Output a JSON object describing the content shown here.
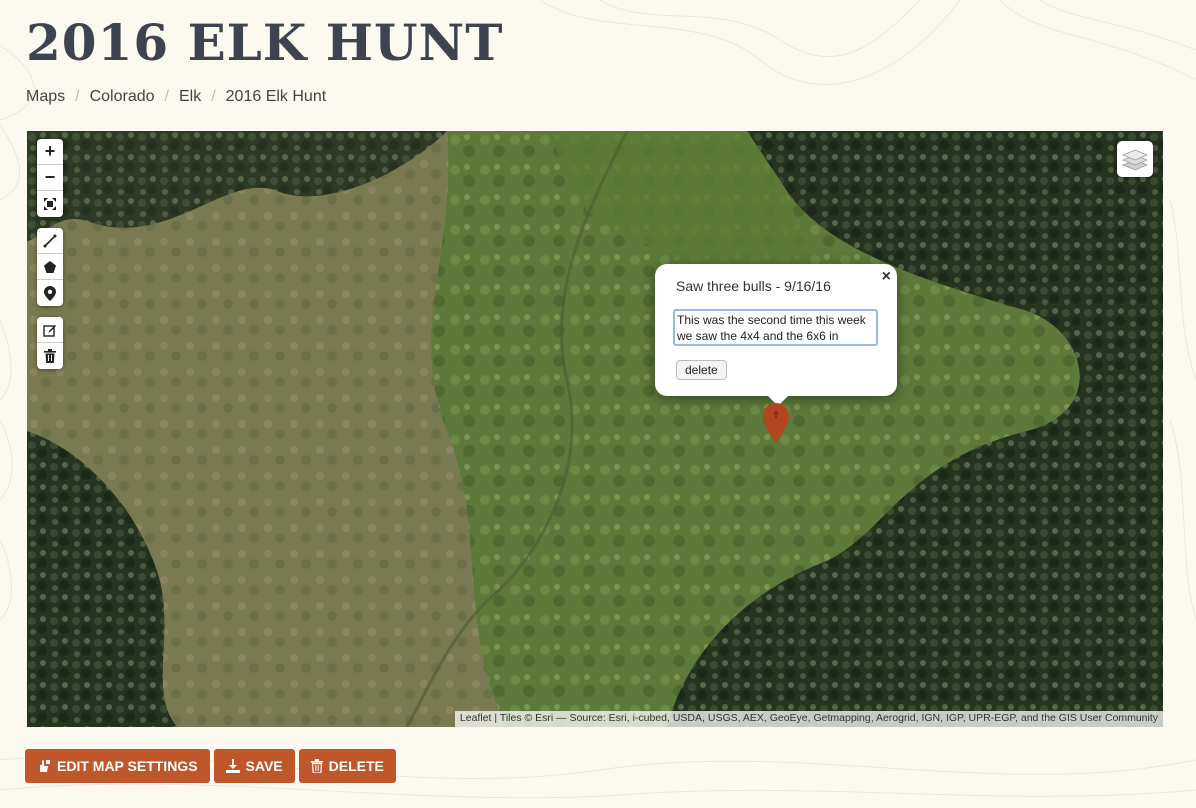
{
  "page": {
    "title": "2016 ELK HUNT"
  },
  "breadcrumb": {
    "items": [
      "Maps",
      "Colorado",
      "Elk",
      "2016 Elk Hunt"
    ],
    "separator": "/"
  },
  "map": {
    "controls": {
      "zoom_in": "+",
      "zoom_out": "−",
      "icons": [
        "fullscreen-icon",
        "polyline-icon",
        "polygon-icon",
        "marker-icon",
        "edit-icon",
        "trash-icon"
      ]
    },
    "layers_icon": "layers-icon",
    "popup": {
      "title": "Saw three bulls - 9/16/16",
      "close": "×",
      "note": "This was the second time this week we saw the 4x4 and the 6x6 in",
      "delete_label": "delete"
    },
    "marker_color": "#b3451f",
    "attribution": "Leaflet | Tiles © Esri — Source: Esri, i-cubed, USDA, USGS, AEX, GeoEye, Getmapping, Aerogrid, IGN, IGP, UPR-EGP, and the GIS User Community"
  },
  "actions": {
    "edit_label": "EDIT MAP SETTINGS",
    "save_label": "SAVE",
    "delete_label": "DELETE"
  },
  "colors": {
    "accent": "#c0572a",
    "title": "#3e4350",
    "background": "#fcfaf0"
  }
}
